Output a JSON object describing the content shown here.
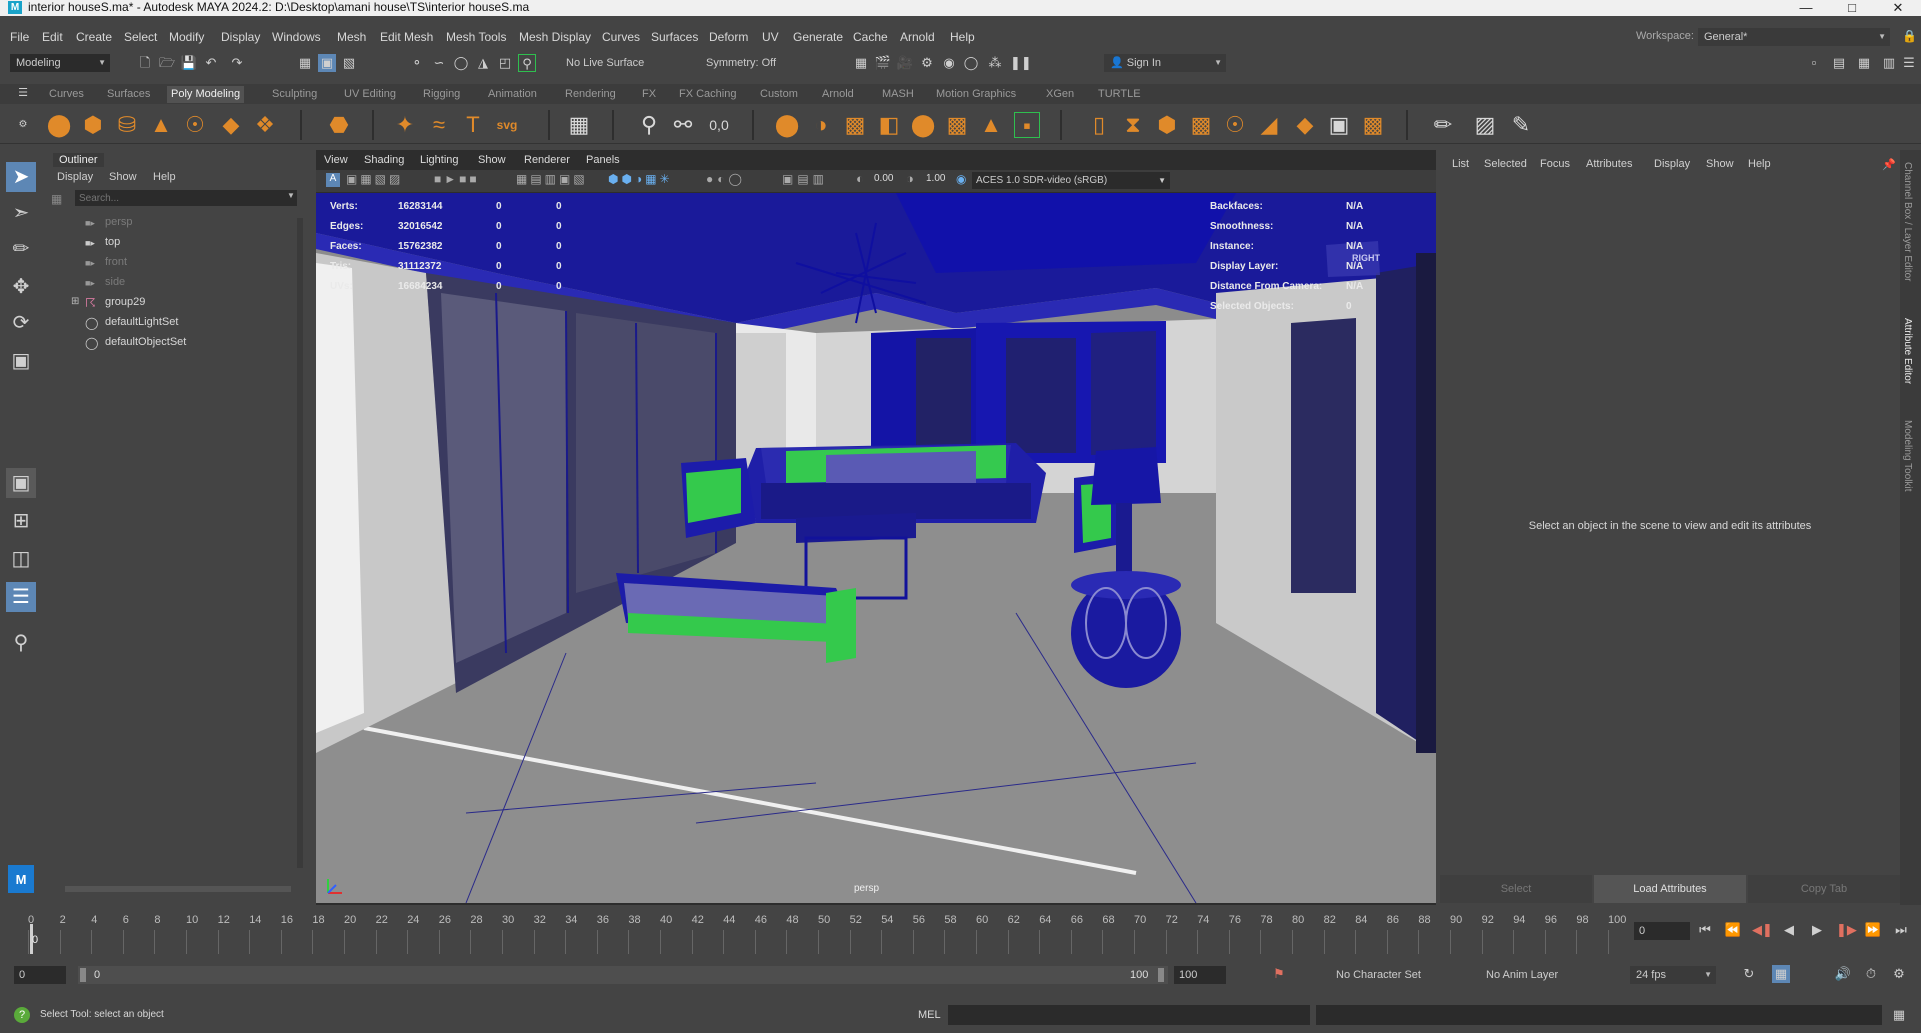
{
  "window": {
    "title": "interior houseS.ma* - Autodesk MAYA 2024.2: D:\\Desktop\\amani house\\TS\\interior houseS.ma",
    "app_icon": "M"
  },
  "menubar": [
    "File",
    "Edit",
    "Create",
    "Select",
    "Modify",
    "Display",
    "Windows",
    "Mesh",
    "Edit Mesh",
    "Mesh Tools",
    "Mesh Display",
    "Curves",
    "Surfaces",
    "Deform",
    "UV",
    "Generate",
    "Cache",
    "Arnold",
    "Help"
  ],
  "workspace": {
    "label": "Workspace:",
    "value": "General*"
  },
  "statusline": {
    "mode": "Modeling",
    "live_surface": "No Live Surface",
    "symmetry": "Symmetry: Off",
    "sign_in": "Sign In"
  },
  "shelf_tabs": [
    "Curves",
    "Surfaces",
    "Poly Modeling",
    "Sculpting",
    "UV Editing",
    "Rigging",
    "Animation",
    "Rendering",
    "FX",
    "FX Caching",
    "Custom",
    "Arnold",
    "MASH",
    "Motion Graphics",
    "XGen",
    "TURTLE"
  ],
  "active_shelf": "Poly Modeling",
  "outliner": {
    "title": "Outliner",
    "menu": [
      "Display",
      "Show",
      "Help"
    ],
    "search_placeholder": "Search...",
    "items": [
      {
        "label": "persp",
        "dim": true
      },
      {
        "label": "top",
        "dim": false
      },
      {
        "label": "front",
        "dim": true
      },
      {
        "label": "side",
        "dim": true
      },
      {
        "label": "group29",
        "dim": false
      },
      {
        "label": "defaultLightSet",
        "dim": false
      },
      {
        "label": "defaultObjectSet",
        "dim": false
      }
    ]
  },
  "viewport": {
    "menu": [
      "View",
      "Shading",
      "Lighting",
      "Show",
      "Renderer",
      "Panels"
    ],
    "exposure": "0.00",
    "gamma": "1.00",
    "colorspace": "ACES 1.0 SDR-video (sRGB)",
    "camera": "persp",
    "view_cube_label": "RIGHT",
    "hud_left": [
      {
        "label": "Verts:",
        "v1": "16283144",
        "v2": "0",
        "v3": "0"
      },
      {
        "label": "Edges:",
        "v1": "32016542",
        "v2": "0",
        "v3": "0"
      },
      {
        "label": "Faces:",
        "v1": "15762382",
        "v2": "0",
        "v3": "0"
      },
      {
        "label": "Tris:",
        "v1": "31112372",
        "v2": "0",
        "v3": "0"
      },
      {
        "label": "UVs:",
        "v1": "16684234",
        "v2": "0",
        "v3": "0"
      }
    ],
    "hud_right": [
      {
        "label": "Backfaces:",
        "value": "N/A"
      },
      {
        "label": "Smoothness:",
        "value": "N/A"
      },
      {
        "label": "Instance:",
        "value": "N/A"
      },
      {
        "label": "Display Layer:",
        "value": "N/A"
      },
      {
        "label": "Distance From Camera:",
        "value": "N/A"
      },
      {
        "label": "Selected Objects:",
        "value": "0"
      }
    ]
  },
  "attribute_editor": {
    "menu": [
      "List",
      "Selected",
      "Focus",
      "Attributes",
      "Display",
      "Show",
      "Help"
    ],
    "message": "Select an object in the scene to view and edit its attributes",
    "buttons": [
      "Select",
      "Load Attributes",
      "Copy Tab"
    ]
  },
  "side_tabs": [
    "Channel Box / Layer Editor",
    "Attribute Editor",
    "Modeling Toolkit"
  ],
  "timeline": {
    "ticks": [
      "0",
      "2",
      "4",
      "6",
      "8",
      "10",
      "12",
      "14",
      "16",
      "18",
      "20",
      "22",
      "24",
      "26",
      "28",
      "30",
      "32",
      "34",
      "36",
      "38",
      "40",
      "42",
      "44",
      "46",
      "48",
      "50",
      "52",
      "54",
      "56",
      "58",
      "60",
      "62",
      "64",
      "66",
      "68",
      "70",
      "72",
      "74",
      "76",
      "78",
      "80",
      "82",
      "84",
      "86",
      "88",
      "90",
      "92",
      "94",
      "96",
      "98",
      "100"
    ],
    "current_marker": "0",
    "current_frame": "0"
  },
  "range": {
    "start": "0",
    "inner_start": "0",
    "inner_end": "100",
    "end": "100",
    "character_set": "No Character Set",
    "anim_layer": "No Anim Layer",
    "fps": "24 fps"
  },
  "commandline": {
    "help": "Select Tool: select an object",
    "lang": "MEL"
  }
}
